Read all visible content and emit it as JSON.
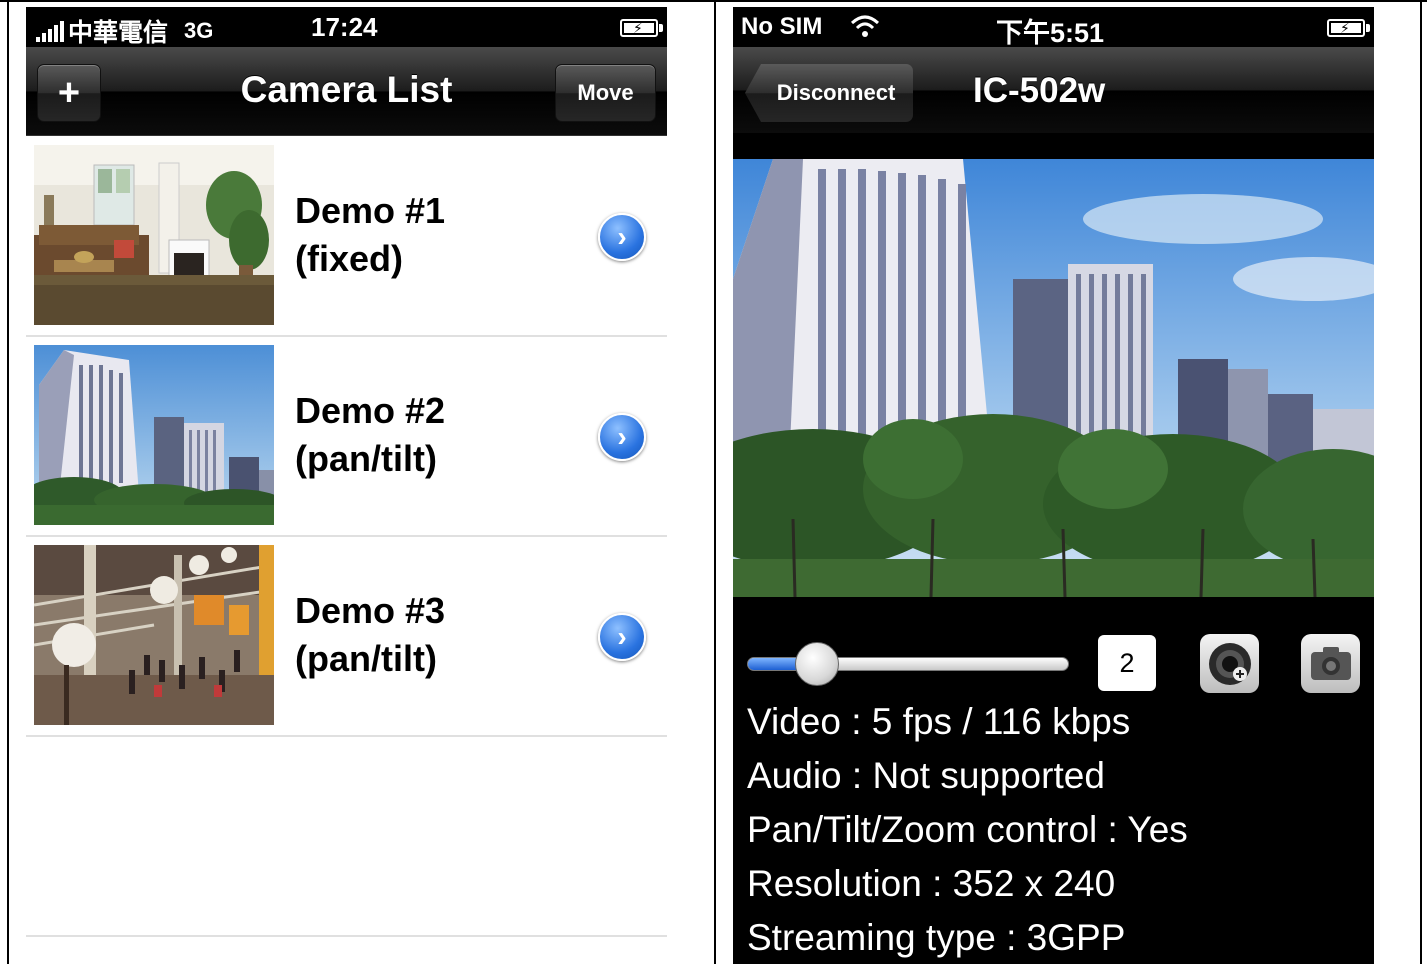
{
  "left_screen": {
    "status": {
      "carrier": "中華電信",
      "network": "3G",
      "time": "17:24"
    },
    "nav": {
      "add_label": "+",
      "title": "Camera List",
      "move_label": "Move"
    },
    "cameras": [
      {
        "name_line1": "Demo #1",
        "name_line2": "(fixed)",
        "thumb": "living-room"
      },
      {
        "name_line1": "Demo #2",
        "name_line2": "(pan/tilt)",
        "thumb": "buildings"
      },
      {
        "name_line1": "Demo #3",
        "name_line2": "(pan/tilt)",
        "thumb": "atrium"
      }
    ]
  },
  "right_screen": {
    "status": {
      "carrier": "No SIM",
      "time": "下午5:51"
    },
    "nav": {
      "back_label": "Disconnect",
      "title": "IC-502w"
    },
    "controls": {
      "zoom_value": "2",
      "slider_level": 0.15,
      "record_icon": "record-icon",
      "snapshot_icon": "camera-icon"
    },
    "info": {
      "video": "Video : 5 fps / 116 kbps",
      "audio": "Audio : Not supported",
      "ptz": "Pan/Tilt/Zoom control : Yes",
      "resolution": "Resolution : 352 x 240",
      "streaming": "Streaming type : 3GPP"
    }
  }
}
